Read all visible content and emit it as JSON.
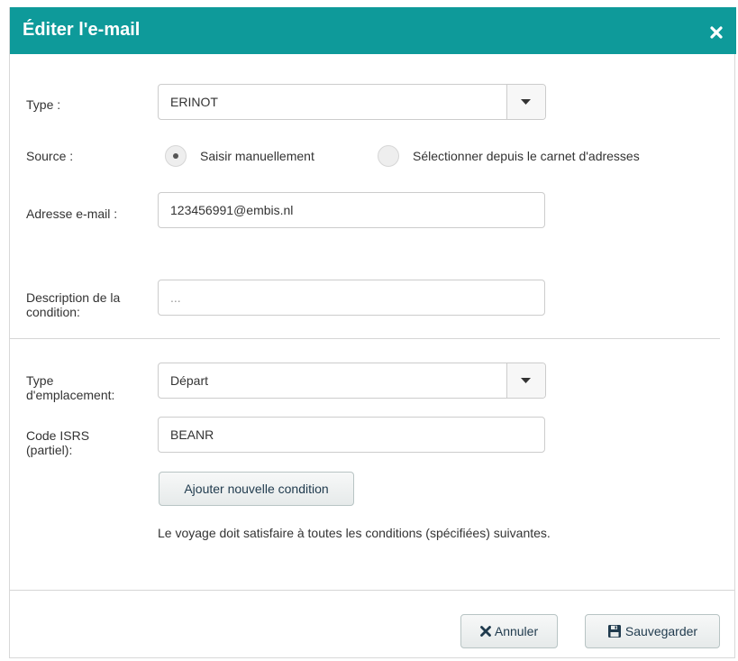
{
  "dialog": {
    "title": "Éditer l'e-mail"
  },
  "form": {
    "type": {
      "label": "Type :",
      "value": "ERINOT"
    },
    "source": {
      "label": "Source :",
      "options": [
        {
          "label": "Saisir manuellement",
          "selected": true
        },
        {
          "label": "Sélectionner depuis le carnet d'adresses",
          "selected": false
        }
      ]
    },
    "email": {
      "label": "Adresse e-mail :",
      "value": "123456991@embis.nl"
    },
    "condition_description": {
      "label_line1": "Description de la",
      "label_line2": "condition:",
      "placeholder": "..."
    },
    "location_type": {
      "label_line1": "Type",
      "label_line2": "d'emplacement:",
      "value": "Départ"
    },
    "isrs_code": {
      "label_line1": "Code ISRS",
      "label_line2": "(partiel):",
      "value": "BEANR"
    },
    "add_condition_label": "Ajouter nouvelle condition",
    "help_text": "Le voyage doit satisfaire à toutes les conditions (spécifiées) suivantes."
  },
  "footer": {
    "cancel_label": "Annuler",
    "save_label": "Sauvegarder"
  },
  "colors": {
    "header": "#0e9a9a",
    "button_text": "#1f3a4d",
    "border": "#cccccc"
  },
  "icons": {
    "close": "close-icon",
    "dropdown": "chevron-down-icon",
    "cancel": "x-icon",
    "save": "floppy-disk-icon"
  }
}
